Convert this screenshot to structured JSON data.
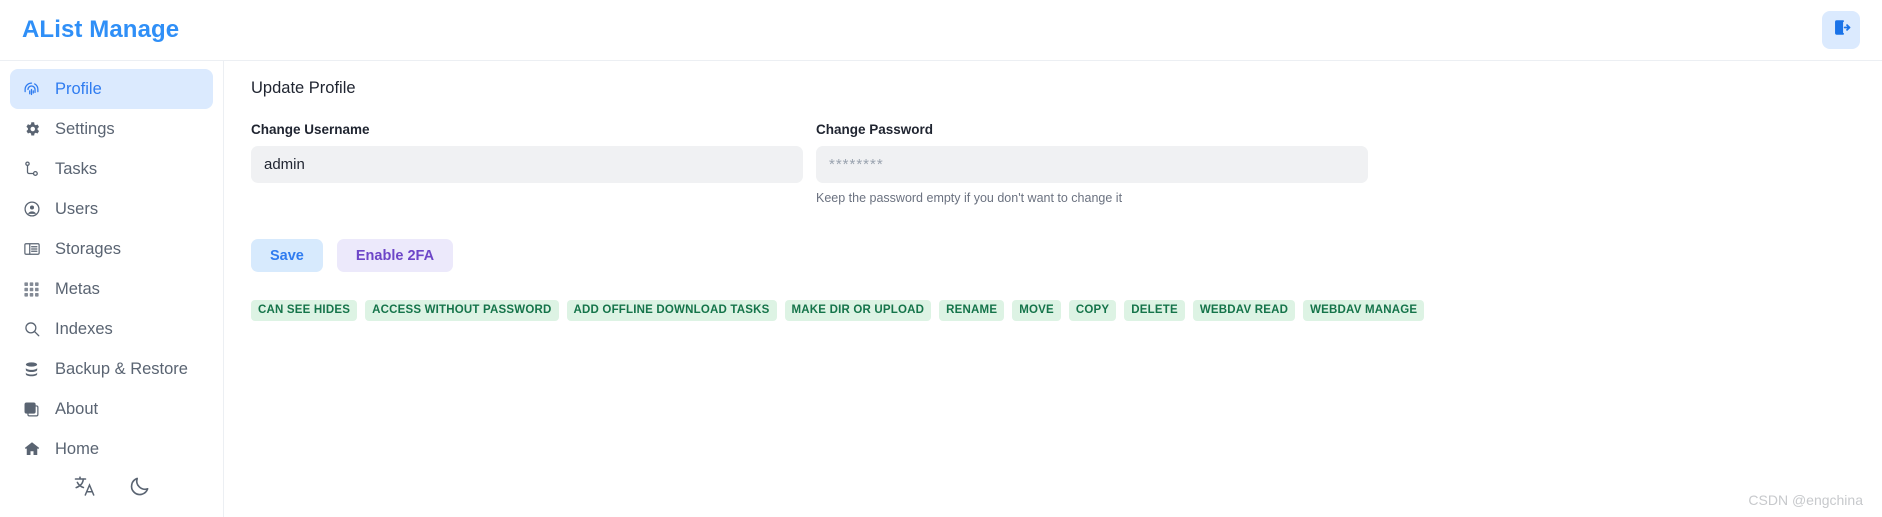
{
  "header": {
    "brand": "AList Manage",
    "logout_icon": "logout-icon"
  },
  "sidebar": {
    "items": [
      {
        "label": "Profile",
        "icon": "fingerprint-icon",
        "active": true,
        "expandable": false
      },
      {
        "label": "Settings",
        "icon": "gear-icon",
        "active": false,
        "expandable": true
      },
      {
        "label": "Tasks",
        "icon": "tasks-icon",
        "active": false,
        "expandable": true
      },
      {
        "label": "Users",
        "icon": "user-circle-icon",
        "active": false,
        "expandable": false
      },
      {
        "label": "Storages",
        "icon": "storage-icon",
        "active": false,
        "expandable": false
      },
      {
        "label": "Metas",
        "icon": "metas-grid-icon",
        "active": false,
        "expandable": false
      },
      {
        "label": "Indexes",
        "icon": "search-icon",
        "active": false,
        "expandable": false
      },
      {
        "label": "Backup & Restore",
        "icon": "database-icon",
        "active": false,
        "expandable": false
      },
      {
        "label": "About",
        "icon": "layers-icon",
        "active": false,
        "expandable": false
      },
      {
        "label": "Home",
        "icon": "home-icon",
        "active": false,
        "expandable": false
      }
    ],
    "footer_icons": [
      {
        "name": "language-icon"
      },
      {
        "name": "dark-mode-moon-icon"
      }
    ]
  },
  "main": {
    "page_title": "Update Profile",
    "username_field": {
      "label": "Change Username",
      "value": "admin",
      "placeholder": ""
    },
    "password_field": {
      "label": "Change Password",
      "value": "",
      "placeholder": "********",
      "hint": "Keep the password empty if you don't want to change it"
    },
    "buttons": {
      "save_label": "Save",
      "enable_2fa_label": "Enable 2FA"
    },
    "permissions": [
      "CAN SEE HIDES",
      "ACCESS WITHOUT PASSWORD",
      "ADD OFFLINE DOWNLOAD TASKS",
      "MAKE DIR OR UPLOAD",
      "RENAME",
      "MOVE",
      "COPY",
      "DELETE",
      "WEBDAV READ",
      "WEBDAV MANAGE"
    ]
  },
  "watermark": "CSDN @engchina",
  "colors": {
    "brand_blue": "#2f8ff7",
    "active_nav_bg": "#dbeafe",
    "active_nav_text": "#2f7cf0",
    "nav_text": "#5a6472",
    "input_bg": "#f0f1f3",
    "save_bg": "#d7eafd",
    "save_text": "#2f7cf0",
    "twofa_bg": "#ece9fb",
    "twofa_text": "#6d46c8",
    "badge_bg": "#ddf3e4",
    "badge_text": "#15744a"
  }
}
